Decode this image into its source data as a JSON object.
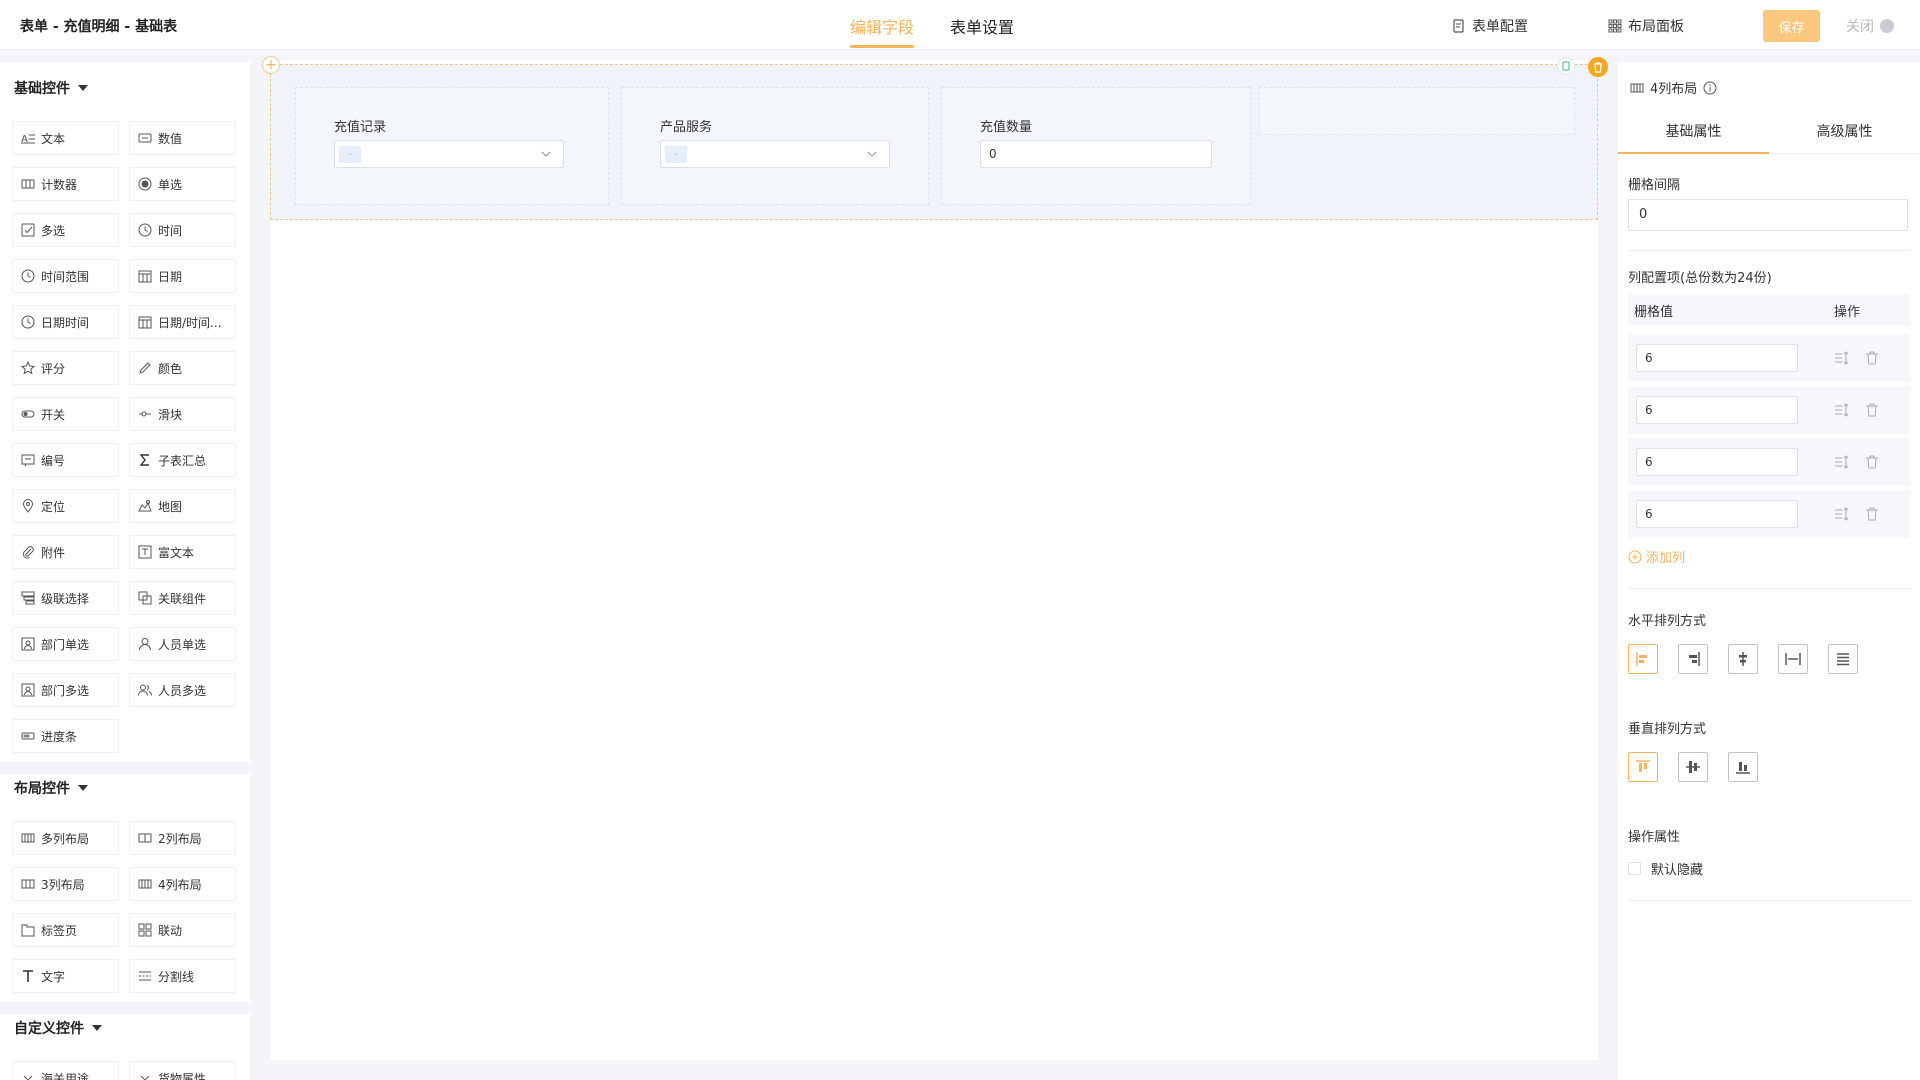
{
  "header": {
    "title": "表单 - 充值明细 - 基础表",
    "tabs": [
      {
        "label": "编辑字段",
        "active": true
      },
      {
        "label": "表单设置",
        "active": false
      }
    ],
    "form_config_label": "表单配置",
    "layout_panel_label": "布局面板",
    "save_label": "保存",
    "close_label": "关闭"
  },
  "left_panel": {
    "sections": [
      {
        "title": "基础控件",
        "items": [
          {
            "label": "文本",
            "icon": "text-icon"
          },
          {
            "label": "数值",
            "icon": "number-icon"
          },
          {
            "label": "计数器",
            "icon": "counter-icon"
          },
          {
            "label": "单选",
            "icon": "radio-icon"
          },
          {
            "label": "多选",
            "icon": "checkbox-icon"
          },
          {
            "label": "时间",
            "icon": "clock-icon"
          },
          {
            "label": "时间范围",
            "icon": "clock-icon"
          },
          {
            "label": "日期",
            "icon": "calendar-icon"
          },
          {
            "label": "日期时间",
            "icon": "clock-icon"
          },
          {
            "label": "日期/时间...",
            "icon": "calendar-icon"
          },
          {
            "label": "评分",
            "icon": "star-icon"
          },
          {
            "label": "颜色",
            "icon": "pen-icon"
          },
          {
            "label": "开关",
            "icon": "toggle-icon"
          },
          {
            "label": "滑块",
            "icon": "slider-icon"
          },
          {
            "label": "编号",
            "icon": "serial-icon"
          },
          {
            "label": "子表汇总",
            "icon": "sigma-icon"
          },
          {
            "label": "定位",
            "icon": "location-icon"
          },
          {
            "label": "地图",
            "icon": "map-icon"
          },
          {
            "label": "附件",
            "icon": "paperclip-icon"
          },
          {
            "label": "富文本",
            "icon": "richtext-icon"
          },
          {
            "label": "级联选择",
            "icon": "cascade-icon"
          },
          {
            "label": "关联组件",
            "icon": "link-icon"
          },
          {
            "label": "部门单选",
            "icon": "department-icon"
          },
          {
            "label": "人员单选",
            "icon": "user-icon"
          },
          {
            "label": "部门多选",
            "icon": "department-icon"
          },
          {
            "label": "人员多选",
            "icon": "users-icon"
          },
          {
            "label": "进度条",
            "icon": "progress-icon"
          }
        ]
      },
      {
        "title": "布局控件",
        "items": [
          {
            "label": "多列布局",
            "icon": "columns-icon"
          },
          {
            "label": "2列布局",
            "icon": "columns-2-icon"
          },
          {
            "label": "3列布局",
            "icon": "columns-3-icon"
          },
          {
            "label": "4列布局",
            "icon": "columns-4-icon"
          },
          {
            "label": "标签页",
            "icon": "tabs-icon"
          },
          {
            "label": "联动",
            "icon": "grid-icon"
          },
          {
            "label": "文字",
            "icon": "text-t-icon"
          },
          {
            "label": "分割线",
            "icon": "divider-icon"
          }
        ]
      },
      {
        "title": "自定义控件",
        "items": [
          {
            "label": "海关用途",
            "icon": "chevron-down-icon"
          },
          {
            "label": "货物属性",
            "icon": "chevron-down-icon"
          }
        ]
      }
    ]
  },
  "canvas": {
    "fields": [
      {
        "label": "充值记录",
        "type": "select",
        "tag": "-"
      },
      {
        "label": "产品服务",
        "type": "select",
        "tag": "-"
      },
      {
        "label": "充值数量",
        "type": "number",
        "value": "0"
      }
    ]
  },
  "right_panel": {
    "title": "4列布局",
    "tabs": [
      {
        "label": "基础属性",
        "active": true
      },
      {
        "label": "高级属性",
        "active": false
      }
    ],
    "gutter_label": "栅格间隔",
    "gutter_value": "0",
    "columns_label": "列配置项(总份数为24份)",
    "col_header_value": "栅格值",
    "col_header_action": "操作",
    "columns": [
      "6",
      "6",
      "6",
      "6"
    ],
    "add_column_label": "添加列",
    "h_align_label": "水平排列方式",
    "v_align_label": "垂直排列方式",
    "op_label": "操作属性",
    "hidden_label": "默认隐藏"
  },
  "colors": {
    "accent": "#f5b45a",
    "save_bg": "#fbc77e",
    "delete": "#f5a623"
  }
}
